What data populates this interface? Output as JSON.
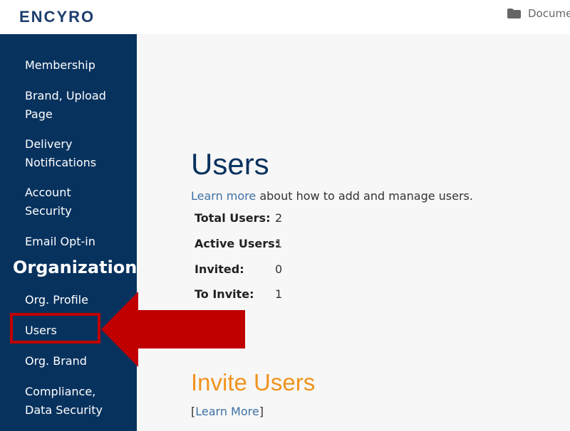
{
  "header": {
    "logo_text": "ENCYRO",
    "docs_label": "Docume"
  },
  "sidebar": {
    "items_top": [
      {
        "label": "Membership"
      },
      {
        "label": "Brand, Upload Page"
      },
      {
        "label": "Delivery Notifications"
      },
      {
        "label": "Account Security"
      },
      {
        "label": "Email Opt-in"
      }
    ],
    "section_heading": "Organization",
    "items_org": [
      {
        "label": "Org. Profile"
      },
      {
        "label": "Users"
      },
      {
        "label": "Org. Brand"
      },
      {
        "label": "Compliance, Data Security"
      }
    ],
    "active_item": "Users"
  },
  "main": {
    "title": "Users",
    "learn_more_link": "Learn more",
    "learn_more_text": " about how to add and manage users.",
    "stats": [
      {
        "label": "Total Users:",
        "value": "2"
      },
      {
        "label": "Active Users:",
        "value": "1"
      },
      {
        "label": "Invited:",
        "value": "0"
      },
      {
        "label": "To Invite:",
        "value": "1"
      }
    ],
    "invite_title": "Invite Users",
    "invite_learn_open": "[",
    "invite_learn_link": "Learn More",
    "invite_learn_close": "]"
  },
  "colors": {
    "sidebar_bg": "#08325e",
    "accent_orange": "#f0931d",
    "link_blue": "#3d71a6",
    "annotation_red": "#c00000"
  },
  "icons": {
    "docs": "folder-icon"
  }
}
